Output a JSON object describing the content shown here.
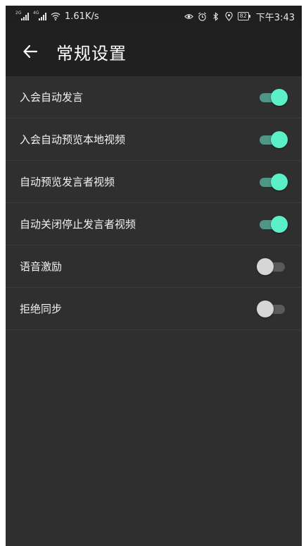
{
  "status_bar": {
    "sim1_label": "2G",
    "sim2_label": "4G",
    "network_speed": "1.61K/s",
    "battery_level": "82",
    "time": "下午3:43",
    "icons": [
      "signal-icon",
      "wifi-icon",
      "eye-icon",
      "alarm-icon",
      "bluetooth-icon",
      "location-icon",
      "battery-icon"
    ]
  },
  "toolbar": {
    "back_icon": "arrow-left-icon",
    "title": "常规设置"
  },
  "settings": [
    {
      "label": "入会自动发言",
      "enabled": true
    },
    {
      "label": "入会自动预览本地视频",
      "enabled": true
    },
    {
      "label": "自动预览发言者视频",
      "enabled": true
    },
    {
      "label": "自动关闭停止发言者视频",
      "enabled": true
    },
    {
      "label": "语音激励",
      "enabled": false
    },
    {
      "label": "拒绝同步",
      "enabled": false
    }
  ],
  "colors": {
    "background": "#2f2f2f",
    "toolbar": "#202020",
    "toggle_on_thumb": "#5cf0c8",
    "toggle_on_track": "#4f9686",
    "toggle_off_thumb": "#d6d6d6",
    "toggle_off_track": "#5a5a5a"
  }
}
